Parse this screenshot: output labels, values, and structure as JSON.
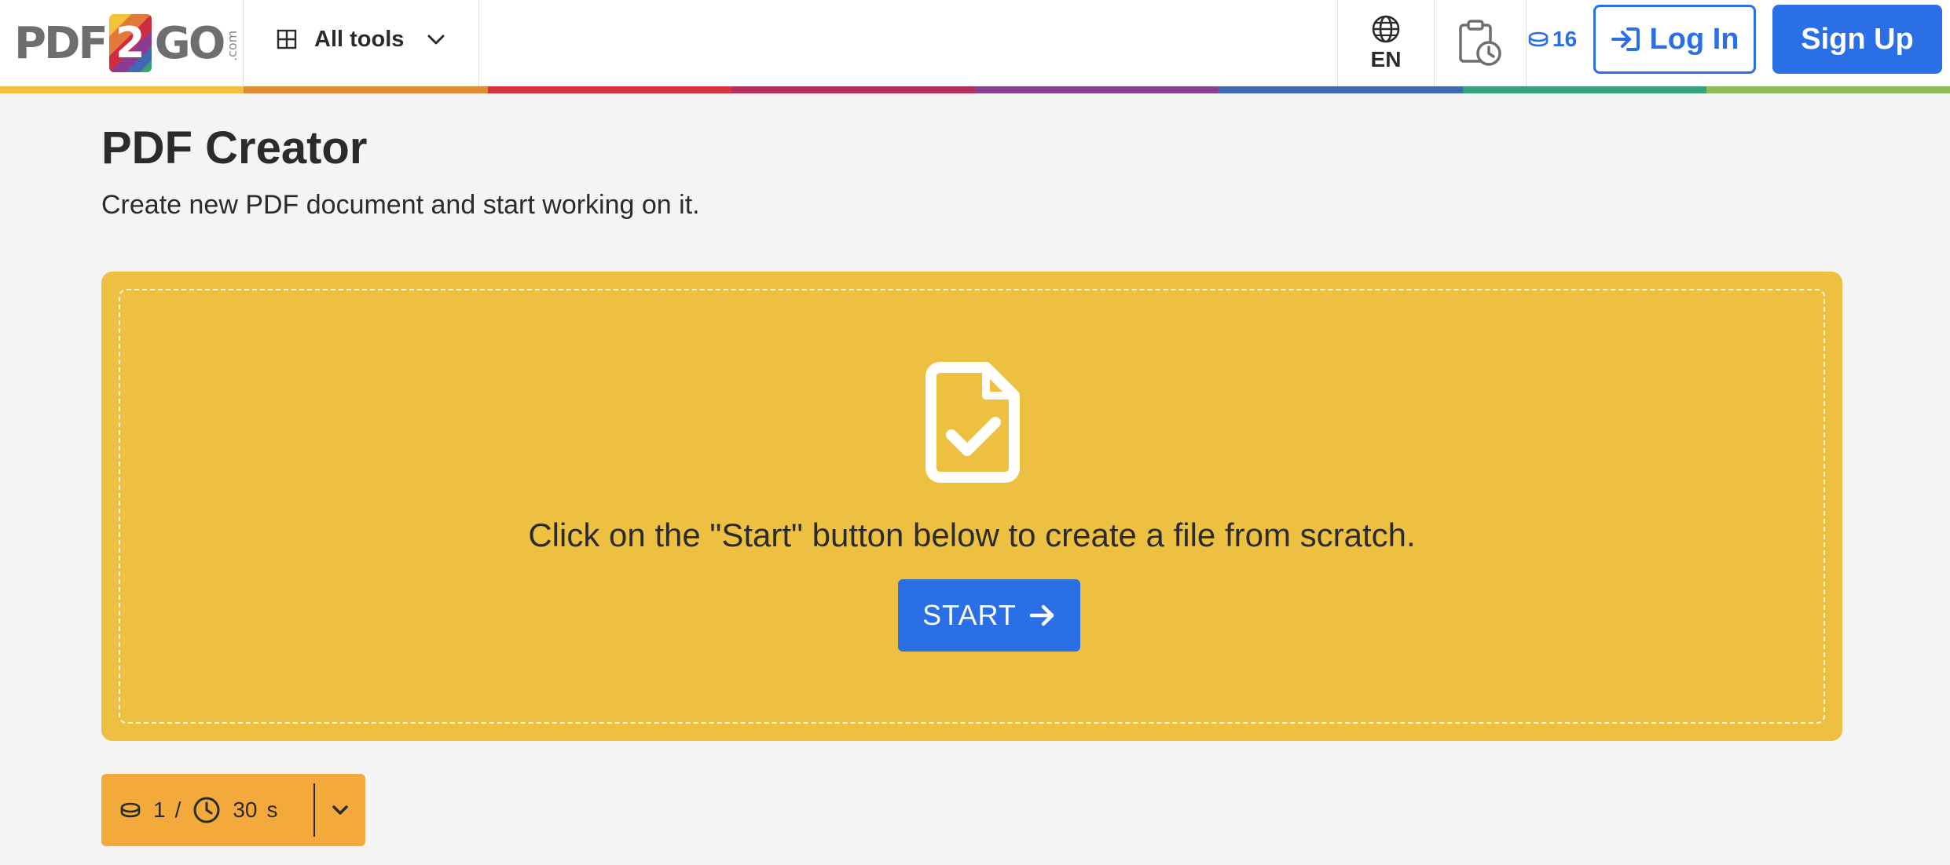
{
  "header": {
    "logo": {
      "left": "PDF",
      "digit": "2",
      "right": "GO",
      "suffix": ".com"
    },
    "all_tools_label": "All tools",
    "language": "EN",
    "credits": "16",
    "login_label": "Log In",
    "signup_label": "Sign Up"
  },
  "colors": {
    "accent_blue": "#2b6fe6",
    "drop_zone": "#edc042",
    "cost_box": "#f4a93b",
    "rainbow": [
      "#f1c040",
      "#e08a34",
      "#d6333f",
      "#b5315d",
      "#85418f",
      "#3f6ab2",
      "#35a07d",
      "#8dbb5a"
    ]
  },
  "main": {
    "title": "PDF Creator",
    "subtitle": "Create new PDF document and start working on it.",
    "instruction": "Click on the \"Start\" button below to create a file from scratch.",
    "start_label": "START"
  },
  "cost": {
    "credits": "1",
    "separator": "/",
    "time": "30",
    "unit": "s"
  }
}
